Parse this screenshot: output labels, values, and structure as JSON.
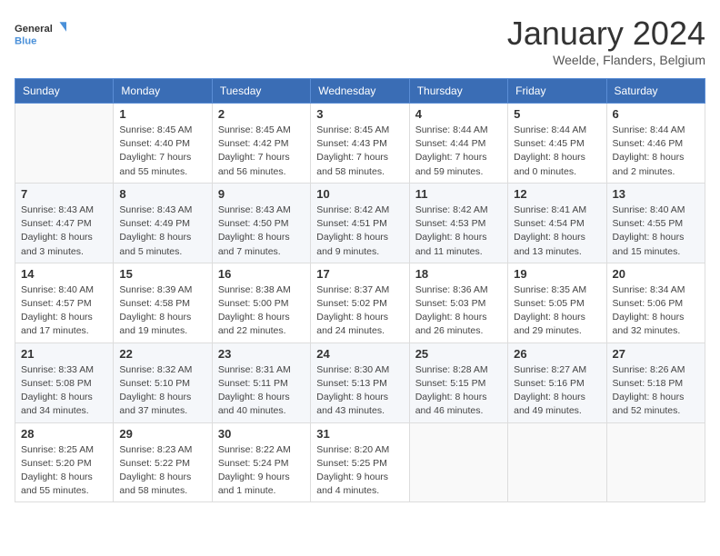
{
  "header": {
    "logo_general": "General",
    "logo_blue": "Blue",
    "month_title": "January 2024",
    "location": "Weelde, Flanders, Belgium"
  },
  "weekdays": [
    "Sunday",
    "Monday",
    "Tuesday",
    "Wednesday",
    "Thursday",
    "Friday",
    "Saturday"
  ],
  "weeks": [
    [
      {
        "day": "",
        "empty": true
      },
      {
        "day": "1",
        "sunrise": "8:45 AM",
        "sunset": "4:40 PM",
        "daylight": "7 hours and 55 minutes."
      },
      {
        "day": "2",
        "sunrise": "8:45 AM",
        "sunset": "4:42 PM",
        "daylight": "7 hours and 56 minutes."
      },
      {
        "day": "3",
        "sunrise": "8:45 AM",
        "sunset": "4:43 PM",
        "daylight": "7 hours and 58 minutes."
      },
      {
        "day": "4",
        "sunrise": "8:44 AM",
        "sunset": "4:44 PM",
        "daylight": "7 hours and 59 minutes."
      },
      {
        "day": "5",
        "sunrise": "8:44 AM",
        "sunset": "4:45 PM",
        "daylight": "8 hours and 0 minutes."
      },
      {
        "day": "6",
        "sunrise": "8:44 AM",
        "sunset": "4:46 PM",
        "daylight": "8 hours and 2 minutes."
      }
    ],
    [
      {
        "day": "7",
        "sunrise": "8:43 AM",
        "sunset": "4:47 PM",
        "daylight": "8 hours and 3 minutes."
      },
      {
        "day": "8",
        "sunrise": "8:43 AM",
        "sunset": "4:49 PM",
        "daylight": "8 hours and 5 minutes."
      },
      {
        "day": "9",
        "sunrise": "8:43 AM",
        "sunset": "4:50 PM",
        "daylight": "8 hours and 7 minutes."
      },
      {
        "day": "10",
        "sunrise": "8:42 AM",
        "sunset": "4:51 PM",
        "daylight": "8 hours and 9 minutes."
      },
      {
        "day": "11",
        "sunrise": "8:42 AM",
        "sunset": "4:53 PM",
        "daylight": "8 hours and 11 minutes."
      },
      {
        "day": "12",
        "sunrise": "8:41 AM",
        "sunset": "4:54 PM",
        "daylight": "8 hours and 13 minutes."
      },
      {
        "day": "13",
        "sunrise": "8:40 AM",
        "sunset": "4:55 PM",
        "daylight": "8 hours and 15 minutes."
      }
    ],
    [
      {
        "day": "14",
        "sunrise": "8:40 AM",
        "sunset": "4:57 PM",
        "daylight": "8 hours and 17 minutes."
      },
      {
        "day": "15",
        "sunrise": "8:39 AM",
        "sunset": "4:58 PM",
        "daylight": "8 hours and 19 minutes."
      },
      {
        "day": "16",
        "sunrise": "8:38 AM",
        "sunset": "5:00 PM",
        "daylight": "8 hours and 22 minutes."
      },
      {
        "day": "17",
        "sunrise": "8:37 AM",
        "sunset": "5:02 PM",
        "daylight": "8 hours and 24 minutes."
      },
      {
        "day": "18",
        "sunrise": "8:36 AM",
        "sunset": "5:03 PM",
        "daylight": "8 hours and 26 minutes."
      },
      {
        "day": "19",
        "sunrise": "8:35 AM",
        "sunset": "5:05 PM",
        "daylight": "8 hours and 29 minutes."
      },
      {
        "day": "20",
        "sunrise": "8:34 AM",
        "sunset": "5:06 PM",
        "daylight": "8 hours and 32 minutes."
      }
    ],
    [
      {
        "day": "21",
        "sunrise": "8:33 AM",
        "sunset": "5:08 PM",
        "daylight": "8 hours and 34 minutes."
      },
      {
        "day": "22",
        "sunrise": "8:32 AM",
        "sunset": "5:10 PM",
        "daylight": "8 hours and 37 minutes."
      },
      {
        "day": "23",
        "sunrise": "8:31 AM",
        "sunset": "5:11 PM",
        "daylight": "8 hours and 40 minutes."
      },
      {
        "day": "24",
        "sunrise": "8:30 AM",
        "sunset": "5:13 PM",
        "daylight": "8 hours and 43 minutes."
      },
      {
        "day": "25",
        "sunrise": "8:28 AM",
        "sunset": "5:15 PM",
        "daylight": "8 hours and 46 minutes."
      },
      {
        "day": "26",
        "sunrise": "8:27 AM",
        "sunset": "5:16 PM",
        "daylight": "8 hours and 49 minutes."
      },
      {
        "day": "27",
        "sunrise": "8:26 AM",
        "sunset": "5:18 PM",
        "daylight": "8 hours and 52 minutes."
      }
    ],
    [
      {
        "day": "28",
        "sunrise": "8:25 AM",
        "sunset": "5:20 PM",
        "daylight": "8 hours and 55 minutes."
      },
      {
        "day": "29",
        "sunrise": "8:23 AM",
        "sunset": "5:22 PM",
        "daylight": "8 hours and 58 minutes."
      },
      {
        "day": "30",
        "sunrise": "8:22 AM",
        "sunset": "5:24 PM",
        "daylight": "9 hours and 1 minute."
      },
      {
        "day": "31",
        "sunrise": "8:20 AM",
        "sunset": "5:25 PM",
        "daylight": "9 hours and 4 minutes."
      },
      {
        "day": "",
        "empty": true
      },
      {
        "day": "",
        "empty": true
      },
      {
        "day": "",
        "empty": true
      }
    ]
  ],
  "labels": {
    "sunrise_prefix": "Sunrise: ",
    "sunset_prefix": "Sunset: ",
    "daylight_prefix": "Daylight: "
  }
}
